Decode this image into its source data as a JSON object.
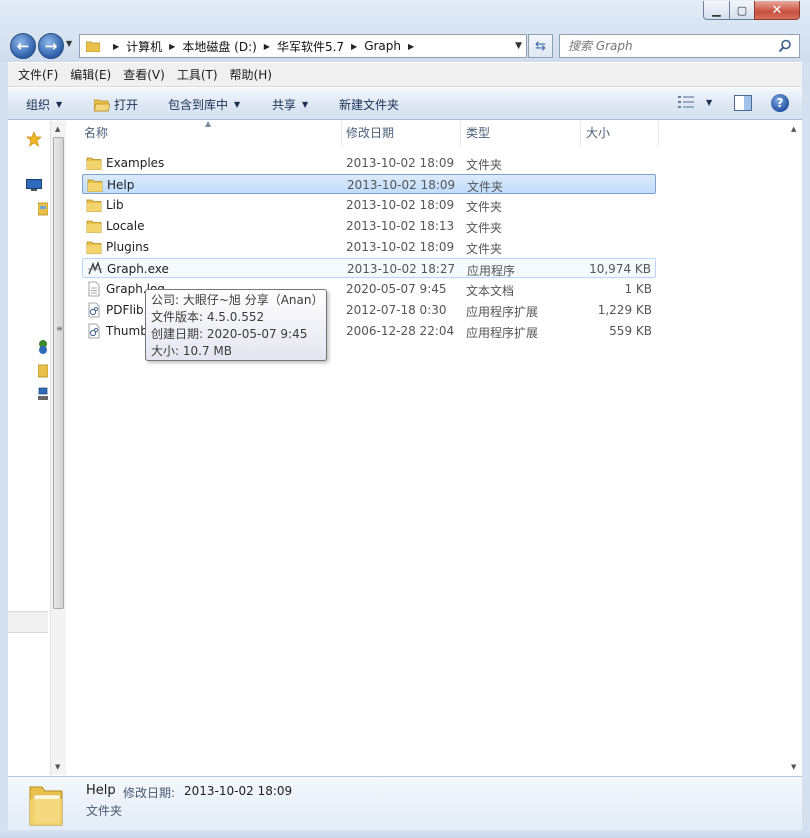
{
  "window": {
    "min_icon": "minimize-icon",
    "max_icon": "maximize-icon",
    "close_icon": "close-icon"
  },
  "address": {
    "breadcrumbs": [
      "计算机",
      "本地磁盘 (D:)",
      "华军软件5.7",
      "Graph"
    ]
  },
  "search": {
    "placeholder": "搜索 Graph"
  },
  "menu": [
    "文件(F)",
    "编辑(E)",
    "查看(V)",
    "工具(T)",
    "帮助(H)"
  ],
  "toolbar": {
    "organize": "组织",
    "open": "打开",
    "include_library": "包含到库中",
    "share": "共享",
    "new_folder": "新建文件夹"
  },
  "columns": {
    "name": "名称",
    "date": "修改日期",
    "type": "类型",
    "size": "大小"
  },
  "files": [
    {
      "name": "Examples",
      "date": "2013-10-02 18:09",
      "type": "文件夹",
      "size": "",
      "icon": "folder-icon"
    },
    {
      "name": "Help",
      "date": "2013-10-02 18:09",
      "type": "文件夹",
      "size": "",
      "icon": "folder-icon"
    },
    {
      "name": "Lib",
      "date": "2013-10-02 18:09",
      "type": "文件夹",
      "size": "",
      "icon": "folder-icon"
    },
    {
      "name": "Locale",
      "date": "2013-10-02 18:13",
      "type": "文件夹",
      "size": "",
      "icon": "folder-icon"
    },
    {
      "name": "Plugins",
      "date": "2013-10-02 18:09",
      "type": "文件夹",
      "size": "",
      "icon": "folder-icon"
    },
    {
      "name": "Graph.exe",
      "date": "2013-10-02 18:27",
      "type": "应用程序",
      "size": "10,974 KB",
      "icon": "exe-icon"
    },
    {
      "name": "Graph.log",
      "date": "2020-05-07 9:45",
      "type": "文本文档",
      "size": "1 KB",
      "icon": "text-file-icon"
    },
    {
      "name": "PDFlib.dll",
      "date": "2012-07-18 0:30",
      "type": "应用程序扩展",
      "size": "1,229 KB",
      "icon": "dll-icon"
    },
    {
      "name": "Thumbnails.dll",
      "date": "2006-12-28 22:04",
      "type": "应用程序扩展",
      "size": "559 KB",
      "icon": "dll-icon"
    }
  ],
  "tooltip": {
    "company": "公司: 大眼仔~旭 分享（Anan）",
    "version": "文件版本: 4.5.0.552",
    "created": "创建日期: 2020-05-07 9:45",
    "size": "大小: 10.7 MB"
  },
  "details": {
    "name": "Help",
    "date_label": "修改日期:",
    "date": "2013-10-02 18:09",
    "type": "文件夹"
  },
  "colors": {
    "selection": "#c9e0fb",
    "accent": "#2b5ea9"
  }
}
